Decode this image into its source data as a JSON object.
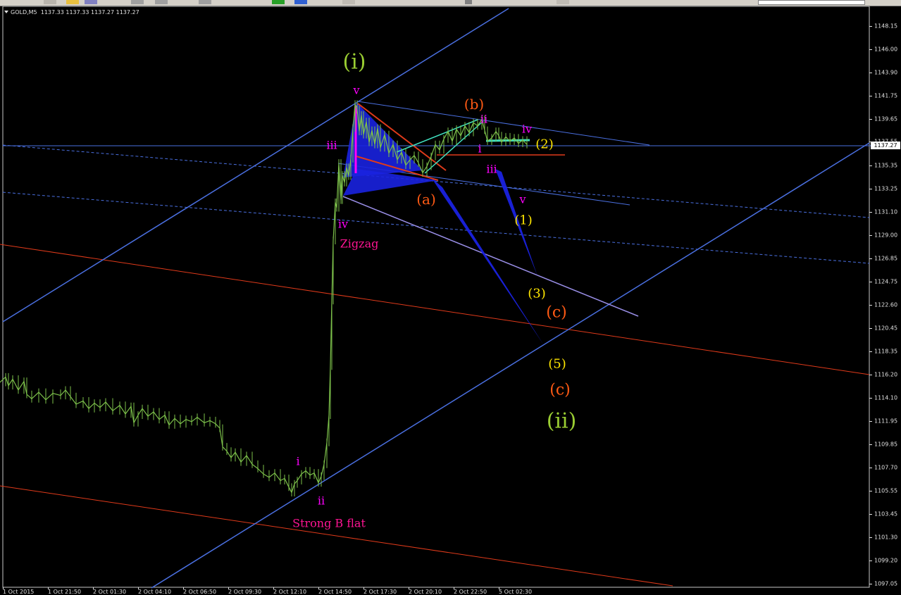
{
  "window": {
    "symbol_label": "GOLD,M5",
    "ohlc_label": "1137.33 1137.33 1137.27 1137.27",
    "current_price": "1137.27"
  },
  "colors": {
    "background": "#000000",
    "candles": "#7cc04a",
    "channel_blue": "#4a6fe0",
    "channel_red": "#e03a1a",
    "fill_blue": "#1a22e0",
    "magenta": "#ff00ff",
    "orange": "#ff5a14",
    "yellow": "#ffe600",
    "olive_green": "#9acd32",
    "pink": "#ff1493",
    "cyan": "#40e0c0",
    "lavender": "#9a8fe8"
  },
  "chart_data": {
    "type": "candlestick",
    "title": "GOLD,M5",
    "price_range": [
      1097.05,
      1150.5
    ],
    "y_ticks": [
      "1148.15",
      "1146.00",
      "1143.90",
      "1141.75",
      "1139.65",
      "1137.55",
      "1135.35",
      "1133.25",
      "1131.10",
      "1129.00",
      "1126.85",
      "1124.75",
      "1122.60",
      "1120.45",
      "1118.35",
      "1116.20",
      "1114.10",
      "1111.95",
      "1109.85",
      "1107.70",
      "1105.55",
      "1103.45",
      "1101.30",
      "1099.20",
      "1097.05"
    ],
    "x_ticks": [
      "1 Oct 2015",
      "1 Oct 21:50",
      "2 Oct 01:30",
      "2 Oct 04:10",
      "2 Oct 06:50",
      "2 Oct 09:30",
      "2 Oct 12:10",
      "2 Oct 14:50",
      "2 Oct 17:30",
      "2 Oct 20:10",
      "2 Oct 22:50",
      "5 Oct 02:30"
    ],
    "price_path": [
      [
        0,
        1115.5
      ],
      [
        8,
        1116.0
      ],
      [
        12,
        1115.2
      ],
      [
        18,
        1115.8
      ],
      [
        26,
        1114.8
      ],
      [
        34,
        1115.6
      ],
      [
        38,
        1114.4
      ],
      [
        45,
        1114.0
      ],
      [
        55,
        1114.6
      ],
      [
        65,
        1113.9
      ],
      [
        75,
        1114.5
      ],
      [
        86,
        1114.3
      ],
      [
        93,
        1114.8
      ],
      [
        100,
        1114.2
      ],
      [
        108,
        1113.5
      ],
      [
        118,
        1113.8
      ],
      [
        126,
        1113.1
      ],
      [
        134,
        1113.6
      ],
      [
        142,
        1113.2
      ],
      [
        150,
        1113.7
      ],
      [
        160,
        1112.9
      ],
      [
        170,
        1113.4
      ],
      [
        178,
        1112.6
      ],
      [
        186,
        1113.3
      ],
      [
        190,
        1111.8
      ],
      [
        196,
        1112.5
      ],
      [
        202,
        1113.1
      ],
      [
        210,
        1112.4
      ],
      [
        218,
        1112.8
      ],
      [
        226,
        1112.1
      ],
      [
        234,
        1112.5
      ],
      [
        240,
        1111.6
      ],
      [
        248,
        1112.2
      ],
      [
        256,
        1111.7
      ],
      [
        264,
        1112.1
      ],
      [
        272,
        1111.9
      ],
      [
        280,
        1112.3
      ],
      [
        290,
        1111.8
      ],
      [
        298,
        1112.0
      ],
      [
        306,
        1111.7
      ],
      [
        312,
        1111.3
      ],
      [
        316,
        1109.6
      ],
      [
        322,
        1109.2
      ],
      [
        328,
        1108.6
      ],
      [
        334,
        1109.1
      ],
      [
        342,
        1108.2
      ],
      [
        350,
        1108.8
      ],
      [
        358,
        1108.0
      ],
      [
        366,
        1107.6
      ],
      [
        374,
        1107.1
      ],
      [
        382,
        1106.8
      ],
      [
        390,
        1107.2
      ],
      [
        398,
        1106.5
      ],
      [
        404,
        1106.7
      ],
      [
        410,
        1105.9
      ],
      [
        414,
        1105.4
      ],
      [
        418,
        1106.2
      ],
      [
        422,
        1106.5
      ],
      [
        428,
        1107.1
      ],
      [
        434,
        1107.4
      ],
      [
        440,
        1107.0
      ],
      [
        446,
        1107.2
      ],
      [
        452,
        1106.3
      ],
      [
        456,
        1106.9
      ],
      [
        460,
        1108.0
      ],
      [
        464,
        1110.0
      ],
      [
        467,
        1112.5
      ],
      [
        469,
        1117.0
      ],
      [
        471,
        1123.0
      ],
      [
        473,
        1128.5
      ],
      [
        476,
        1132.0
      ],
      [
        478,
        1131.5
      ],
      [
        481,
        1135.6
      ],
      [
        484,
        1132.2
      ],
      [
        486,
        1134.5
      ],
      [
        489,
        1133.8
      ],
      [
        492,
        1135.2
      ],
      [
        495,
        1134.4
      ],
      [
        498,
        1136.0
      ],
      [
        501,
        1138.8
      ],
      [
        504,
        1141.0
      ],
      [
        507,
        1140.5
      ],
      [
        510,
        1138.5
      ],
      [
        513,
        1140.0
      ],
      [
        516,
        1138.2
      ],
      [
        520,
        1139.4
      ],
      [
        524,
        1137.5
      ],
      [
        528,
        1138.6
      ],
      [
        532,
        1137.3
      ],
      [
        536,
        1138.8
      ],
      [
        540,
        1137.0
      ],
      [
        546,
        1138.2
      ],
      [
        552,
        1136.5
      ],
      [
        558,
        1137.3
      ],
      [
        564,
        1135.9
      ],
      [
        570,
        1136.6
      ],
      [
        576,
        1135.4
      ],
      [
        582,
        1135.9
      ],
      [
        588,
        1136.3
      ],
      [
        594,
        1135.6
      ],
      [
        600,
        1134.7
      ],
      [
        606,
        1135.3
      ],
      [
        612,
        1136.2
      ],
      [
        618,
        1137.3
      ],
      [
        624,
        1136.8
      ],
      [
        630,
        1137.8
      ],
      [
        636,
        1138.5
      ],
      [
        642,
        1137.6
      ],
      [
        648,
        1138.7
      ],
      [
        654,
        1138.1
      ],
      [
        660,
        1139.0
      ],
      [
        666,
        1138.4
      ],
      [
        672,
        1139.3
      ],
      [
        678,
        1139.0
      ],
      [
        684,
        1139.6
      ],
      [
        688,
        1138.6
      ],
      [
        692,
        1137.6
      ],
      [
        698,
        1137.9
      ],
      [
        704,
        1138.5
      ],
      [
        708,
        1138.1
      ],
      [
        712,
        1137.5
      ],
      [
        718,
        1138.0
      ],
      [
        724,
        1137.6
      ],
      [
        730,
        1137.9
      ],
      [
        736,
        1137.4
      ],
      [
        742,
        1137.7
      ],
      [
        748,
        1137.3
      ]
    ]
  },
  "annotations": {
    "wave_i_circled": "(i)",
    "wave_ii_circled": "(ii)",
    "sub_v_top": "v",
    "sub_iii_left": "iii",
    "sub_iv_left": "iv",
    "zigzag": "Zigzag",
    "sub_i_bottom": "i",
    "sub_ii_bottom": "ii",
    "strong_b_flat": "Strong B flat",
    "label_b": "(b)",
    "label_a": "(a)",
    "label_c_upper": "(c)",
    "label_c_lower": "(c)",
    "sub_ii_right": "ii",
    "sub_i_right": "i",
    "sub_iii_right": "iii",
    "sub_iv_right": "iv",
    "sub_v_right": "v",
    "label_1": "(1)",
    "label_2": "(2)",
    "label_3": "(3)",
    "label_5": "(5)"
  }
}
